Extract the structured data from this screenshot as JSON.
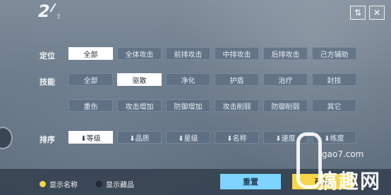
{
  "header": {
    "page_current": "2",
    "page_total": "7",
    "filter_icon": "filter-icon",
    "close_icon": "close-icon"
  },
  "rows": {
    "position": {
      "label": "定位",
      "options": [
        "全部",
        "全体攻击",
        "前排攻击",
        "中排攻击",
        "后排攻击",
        "己方辅助"
      ]
    },
    "skill": {
      "label": "技能",
      "options": [
        "全部",
        "驱散",
        "净化",
        "护盾",
        "治疗",
        "封技",
        "重伤",
        "攻击增加",
        "防御增加",
        "攻击削弱",
        "防御削弱",
        "其它"
      ]
    },
    "sort": {
      "label": "排序",
      "options": [
        "⬇等级",
        "⬇品质",
        "⬇星级",
        "⬇名称",
        "⬇速度",
        "⬇练度"
      ]
    }
  },
  "bottom": {
    "show_name": "显示名称",
    "show_collection": "显示藏品",
    "reset": "重置",
    "confirm": "确认"
  },
  "watermark": {
    "site": "gao7.com",
    "brand": "搞趣网"
  },
  "colors": {
    "selected_bg": "#ffffff",
    "option_bg": "#5c6e82",
    "reset_bg": "#7fd4ff",
    "confirm_bg": "#f6d54b",
    "radio_on": "#f5d44a"
  }
}
